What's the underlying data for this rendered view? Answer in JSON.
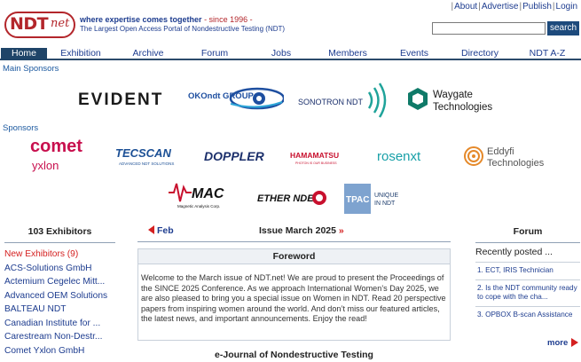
{
  "header": {
    "logo_text": "NDT",
    "logo_suffix": "net",
    "tagline": "where expertise comes together",
    "since": " - since 1996 -",
    "subtitle": "The Largest Open Access Portal of Nondestructive Testing (NDT)",
    "top_links": [
      "About",
      "Advertise",
      "Publish",
      "Login"
    ],
    "search_placeholder": "",
    "search_button": "search"
  },
  "nav": {
    "items": [
      "Home",
      "Exhibition",
      "Archive",
      "Forum",
      "Jobs",
      "Members",
      "Events",
      "Directory",
      "NDT A-Z"
    ],
    "active": "Home"
  },
  "sponsors": {
    "main_title": "Main Sponsors",
    "main": [
      "EVIDENT",
      "OKOndt GROUP",
      "SONOTRON NDT",
      "Waygate Technologies"
    ],
    "title": "Sponsors",
    "row1": [
      "comet",
      "yxlon",
      "TECSCAN",
      "ADVANCED NDT SOLUTIONS",
      "DOPPLER",
      "HAMAMATSU",
      "PHOTON IS OUR BUSINESS",
      "rosenxt",
      "Eddyfi",
      "Technologies"
    ],
    "row2": [
      "MAC",
      "Magnetic Analysis Corp.",
      "ETHER NDE",
      "TPAC",
      "UNIQUE",
      "IN NDT"
    ]
  },
  "exhibitors": {
    "title": "103 Exhibitors",
    "items": [
      "New Exhibitors (9)",
      "ACS-Solutions GmbH",
      "Actemium Cegelec Mitt...",
      "Advanced OEM Solutions",
      "BALTEAU NDT",
      "Canadian Institute for ...",
      "Carestream Non-Destr...",
      "Comet Yxlon GmbH"
    ]
  },
  "issue": {
    "prev_label": "Feb",
    "title": "Issue March 2025",
    "next_marker": "»",
    "foreword_title": "Foreword",
    "foreword_text": "Welcome to the March issue of NDT.net! We are proud to present the Proceedings of the SINCE 2025 Conference. As we approach International Women’s Day 2025, we are also pleased to bring you a special issue on Women in NDT. Read 20 perspective papers from inspiring women around the world. And don’t miss our featured articles, the latest news, and important announcements. Enjoy the read!",
    "ejournal_title": "e-Journal of Nondestructive Testing"
  },
  "forum": {
    "title": "Forum",
    "recent_title": "Recently posted ...",
    "items": [
      "1. ECT, IRIS Technician",
      "2. Is the NDT community ready to cope with the cha...",
      "3. OPBOX B-scan Assistance"
    ],
    "more_label": "more"
  },
  "colors": {
    "brand_red": "#b3262b",
    "link_blue": "#1d3c8f",
    "nav_active": "#1f4468",
    "alert_red": "#d42020"
  }
}
